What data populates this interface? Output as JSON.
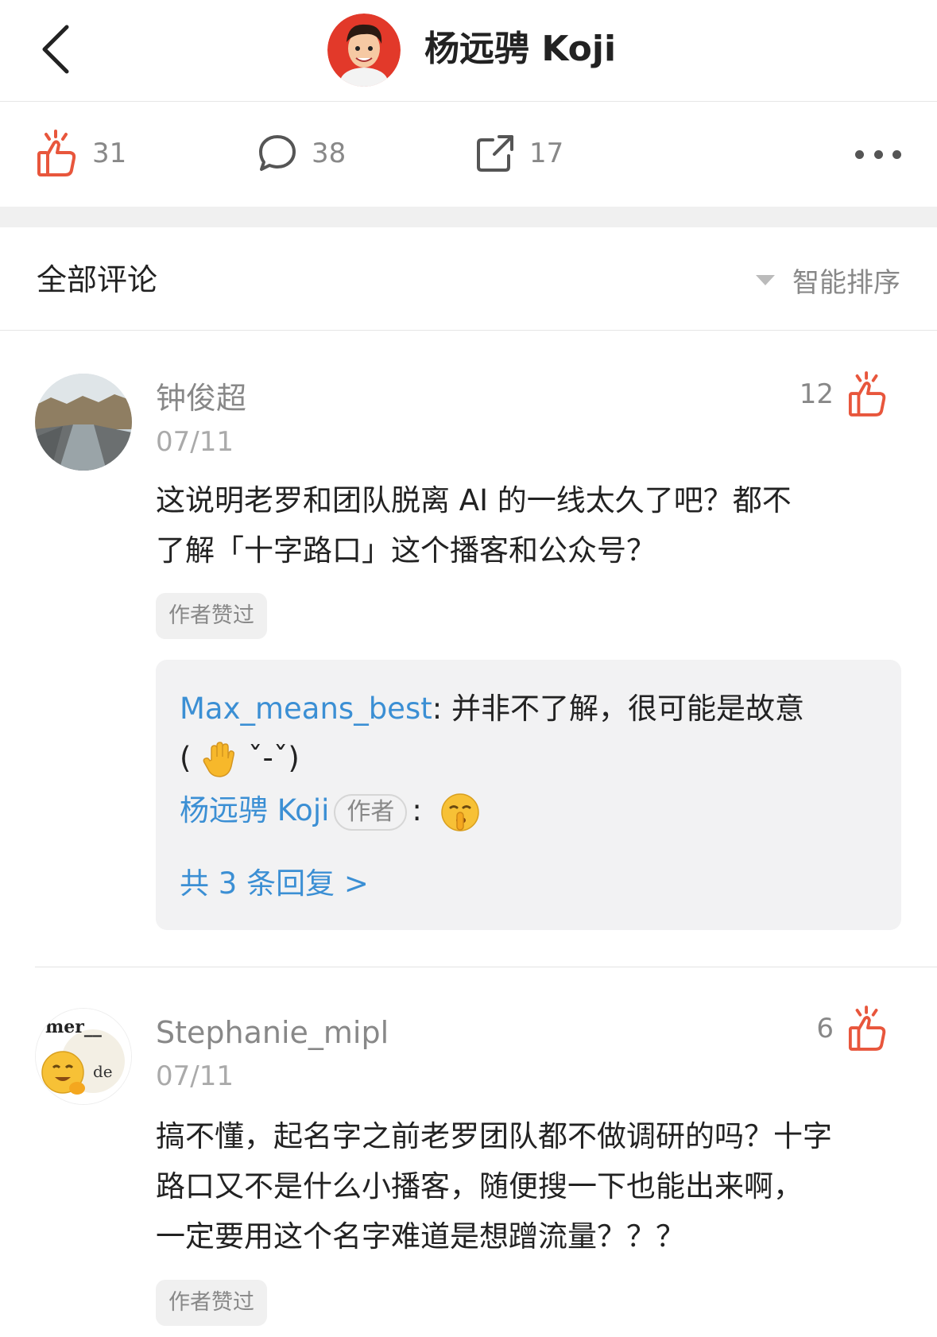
{
  "header": {
    "title": "杨远骋 Koji"
  },
  "actions": {
    "like_count": "31",
    "comment_count": "38",
    "share_count": "17"
  },
  "comments_section": {
    "title": "全部评论",
    "sort_label": "智能排序"
  },
  "comments": [
    {
      "user": "钟俊超",
      "date": "07/11",
      "likes": "12",
      "text_line1": "这说明老罗和团队脱离 AI 的一线太久了吧？都不",
      "text_line2": "了解「十字路口」这个播客和公众号？",
      "badge": "作者赞过",
      "replies": {
        "reply1_user": "Max_means_best",
        "reply1_sep": ": ",
        "reply1_text": "并非不了解，很可能是故意",
        "reply1_line2_open": "(",
        "reply1_line2_face": "ˇ-ˇ)",
        "reply2_user": "杨远骋 Koji",
        "reply2_tag": "作者",
        "reply2_sep": ":",
        "more_label": "共 3 条回复 >"
      }
    },
    {
      "user": "Stephanie_mipl",
      "date": "07/11",
      "likes": "6",
      "avatar_text_top": "mer__",
      "avatar_text_mid": "de",
      "text_line1": "搞不懂，起名字之前老罗团队都不做调研的吗？十字",
      "text_line2": "路口又不是什么小播客，随便搜一下也能出来啊，",
      "text_line3": "一定要用这个名字难道是想蹭流量？？？",
      "badge": "作者赞过"
    }
  ],
  "colors": {
    "accent_red": "#e8563c",
    "link_blue": "#3b8fd4",
    "muted_gray": "#888888"
  }
}
